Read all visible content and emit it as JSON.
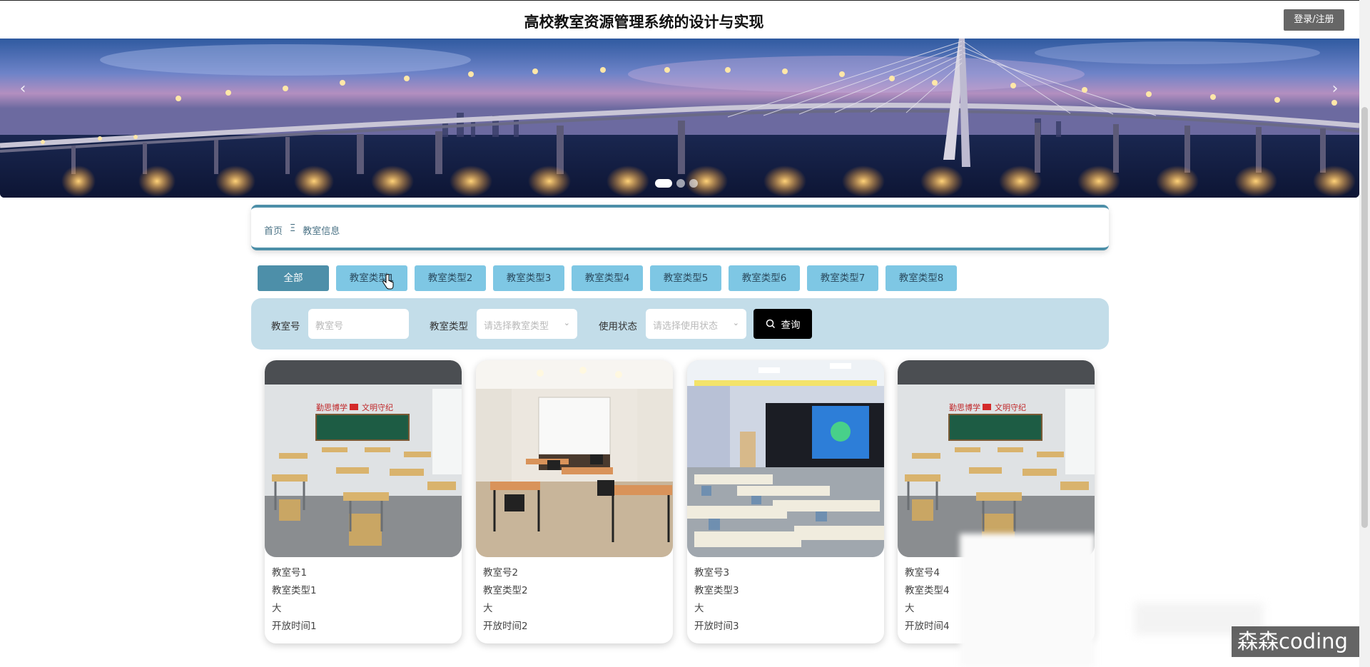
{
  "header": {
    "title": "高校教室资源管理系统的设计与实现",
    "login_label": "登录/注册"
  },
  "banner": {
    "prev_icon": "chevron-left-icon",
    "next_icon": "chevron-right-icon",
    "slide_count": 3,
    "active_slide": 1,
    "prev_glyph": "‹",
    "next_glyph": "›"
  },
  "breadcrumb": {
    "home": "首页",
    "separator": "Ξ",
    "current": "教室信息"
  },
  "tabs": [
    {
      "label": "全部",
      "active": true
    },
    {
      "label": "教室类型1",
      "active": false
    },
    {
      "label": "教室类型2",
      "active": false
    },
    {
      "label": "教室类型3",
      "active": false
    },
    {
      "label": "教室类型4",
      "active": false
    },
    {
      "label": "教室类型5",
      "active": false
    },
    {
      "label": "教室类型6",
      "active": false
    },
    {
      "label": "教室类型7",
      "active": false
    },
    {
      "label": "教室类型8",
      "active": false
    }
  ],
  "filters": {
    "room_label": "教室号",
    "room_placeholder": "教室号",
    "type_label": "教室类型",
    "type_placeholder": "请选择教室类型",
    "status_label": "使用状态",
    "status_placeholder": "请选择使用状态",
    "search_label": "查询",
    "chev": "⌄"
  },
  "cards": [
    {
      "room": "教室号1",
      "type": "教室类型1",
      "size": "大",
      "open": "开放时间1"
    },
    {
      "room": "教室号2",
      "type": "教室类型2",
      "size": "大",
      "open": "开放时间2"
    },
    {
      "room": "教室号3",
      "type": "教室类型3",
      "size": "大",
      "open": "开放时间3"
    },
    {
      "room": "教室号4",
      "type": "教室类型4",
      "size": "大",
      "open": "开放时间4"
    }
  ],
  "image_text": {
    "slogan": "勤思博学",
    "slogan2": "文明守纪"
  },
  "watermark": "森森coding",
  "colors": {
    "tab": "#7ec7e4",
    "tab_active": "#4d8fa9",
    "filter_bg": "#c3dde9",
    "accent": "#4c8fa8"
  }
}
